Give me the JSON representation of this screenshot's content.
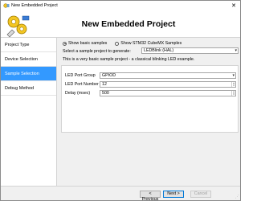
{
  "window": {
    "title": "New Embedded Project",
    "close_label": "✕"
  },
  "header": {
    "heading": "New Embedded Project"
  },
  "sidebar": {
    "items": [
      {
        "label": "Project Type",
        "active": false
      },
      {
        "label": "Device Selection",
        "active": false
      },
      {
        "label": "Sample Selection",
        "active": true
      },
      {
        "label": "Debug Method",
        "active": false
      }
    ]
  },
  "content": {
    "radio_basic": "Show basic samples",
    "radio_cubemx": "Show STM32 CubeMX Samples",
    "select_label": "Select a sample project to generate:",
    "select_value": "LEDBlink (HAL)",
    "description": "This is a very basic sample project - a classical blinking LED example.",
    "fields": {
      "port_group_label": "LED Port Group",
      "port_group_value": "GPIOD",
      "port_number_label": "LED Port Number",
      "port_number_value": "12",
      "delay_label": "Delay (msec)",
      "delay_value": "500"
    }
  },
  "footer": {
    "previous": "< Previous",
    "next": "Next >",
    "cancel": "Cancel"
  }
}
